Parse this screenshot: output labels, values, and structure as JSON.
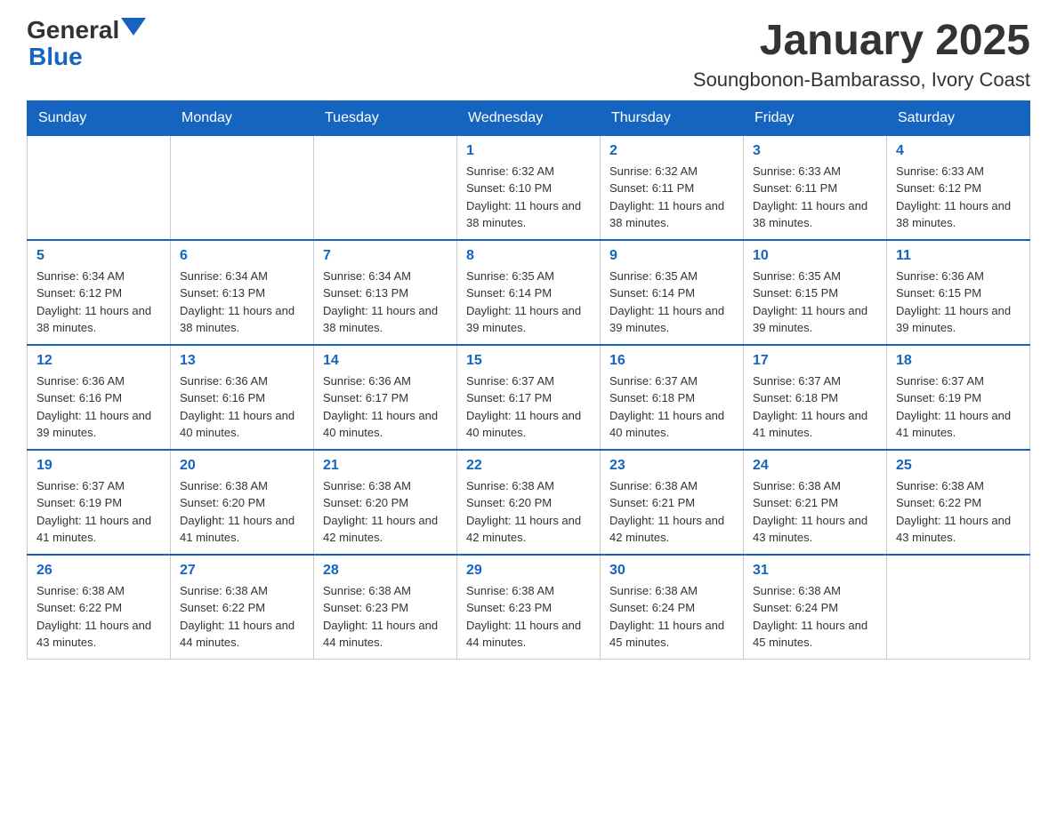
{
  "header": {
    "logo": {
      "general": "General",
      "triangle": "▼",
      "blue": "Blue"
    },
    "title": "January 2025",
    "subtitle": "Soungbonon-Bambarasso, Ivory Coast"
  },
  "days_of_week": [
    "Sunday",
    "Monday",
    "Tuesday",
    "Wednesday",
    "Thursday",
    "Friday",
    "Saturday"
  ],
  "weeks": [
    [
      {
        "day": "",
        "info": ""
      },
      {
        "day": "",
        "info": ""
      },
      {
        "day": "",
        "info": ""
      },
      {
        "day": "1",
        "info": "Sunrise: 6:32 AM\nSunset: 6:10 PM\nDaylight: 11 hours and 38 minutes."
      },
      {
        "day": "2",
        "info": "Sunrise: 6:32 AM\nSunset: 6:11 PM\nDaylight: 11 hours and 38 minutes."
      },
      {
        "day": "3",
        "info": "Sunrise: 6:33 AM\nSunset: 6:11 PM\nDaylight: 11 hours and 38 minutes."
      },
      {
        "day": "4",
        "info": "Sunrise: 6:33 AM\nSunset: 6:12 PM\nDaylight: 11 hours and 38 minutes."
      }
    ],
    [
      {
        "day": "5",
        "info": "Sunrise: 6:34 AM\nSunset: 6:12 PM\nDaylight: 11 hours and 38 minutes."
      },
      {
        "day": "6",
        "info": "Sunrise: 6:34 AM\nSunset: 6:13 PM\nDaylight: 11 hours and 38 minutes."
      },
      {
        "day": "7",
        "info": "Sunrise: 6:34 AM\nSunset: 6:13 PM\nDaylight: 11 hours and 38 minutes."
      },
      {
        "day": "8",
        "info": "Sunrise: 6:35 AM\nSunset: 6:14 PM\nDaylight: 11 hours and 39 minutes."
      },
      {
        "day": "9",
        "info": "Sunrise: 6:35 AM\nSunset: 6:14 PM\nDaylight: 11 hours and 39 minutes."
      },
      {
        "day": "10",
        "info": "Sunrise: 6:35 AM\nSunset: 6:15 PM\nDaylight: 11 hours and 39 minutes."
      },
      {
        "day": "11",
        "info": "Sunrise: 6:36 AM\nSunset: 6:15 PM\nDaylight: 11 hours and 39 minutes."
      }
    ],
    [
      {
        "day": "12",
        "info": "Sunrise: 6:36 AM\nSunset: 6:16 PM\nDaylight: 11 hours and 39 minutes."
      },
      {
        "day": "13",
        "info": "Sunrise: 6:36 AM\nSunset: 6:16 PM\nDaylight: 11 hours and 40 minutes."
      },
      {
        "day": "14",
        "info": "Sunrise: 6:36 AM\nSunset: 6:17 PM\nDaylight: 11 hours and 40 minutes."
      },
      {
        "day": "15",
        "info": "Sunrise: 6:37 AM\nSunset: 6:17 PM\nDaylight: 11 hours and 40 minutes."
      },
      {
        "day": "16",
        "info": "Sunrise: 6:37 AM\nSunset: 6:18 PM\nDaylight: 11 hours and 40 minutes."
      },
      {
        "day": "17",
        "info": "Sunrise: 6:37 AM\nSunset: 6:18 PM\nDaylight: 11 hours and 41 minutes."
      },
      {
        "day": "18",
        "info": "Sunrise: 6:37 AM\nSunset: 6:19 PM\nDaylight: 11 hours and 41 minutes."
      }
    ],
    [
      {
        "day": "19",
        "info": "Sunrise: 6:37 AM\nSunset: 6:19 PM\nDaylight: 11 hours and 41 minutes."
      },
      {
        "day": "20",
        "info": "Sunrise: 6:38 AM\nSunset: 6:20 PM\nDaylight: 11 hours and 41 minutes."
      },
      {
        "day": "21",
        "info": "Sunrise: 6:38 AM\nSunset: 6:20 PM\nDaylight: 11 hours and 42 minutes."
      },
      {
        "day": "22",
        "info": "Sunrise: 6:38 AM\nSunset: 6:20 PM\nDaylight: 11 hours and 42 minutes."
      },
      {
        "day": "23",
        "info": "Sunrise: 6:38 AM\nSunset: 6:21 PM\nDaylight: 11 hours and 42 minutes."
      },
      {
        "day": "24",
        "info": "Sunrise: 6:38 AM\nSunset: 6:21 PM\nDaylight: 11 hours and 43 minutes."
      },
      {
        "day": "25",
        "info": "Sunrise: 6:38 AM\nSunset: 6:22 PM\nDaylight: 11 hours and 43 minutes."
      }
    ],
    [
      {
        "day": "26",
        "info": "Sunrise: 6:38 AM\nSunset: 6:22 PM\nDaylight: 11 hours and 43 minutes."
      },
      {
        "day": "27",
        "info": "Sunrise: 6:38 AM\nSunset: 6:22 PM\nDaylight: 11 hours and 44 minutes."
      },
      {
        "day": "28",
        "info": "Sunrise: 6:38 AM\nSunset: 6:23 PM\nDaylight: 11 hours and 44 minutes."
      },
      {
        "day": "29",
        "info": "Sunrise: 6:38 AM\nSunset: 6:23 PM\nDaylight: 11 hours and 44 minutes."
      },
      {
        "day": "30",
        "info": "Sunrise: 6:38 AM\nSunset: 6:24 PM\nDaylight: 11 hours and 45 minutes."
      },
      {
        "day": "31",
        "info": "Sunrise: 6:38 AM\nSunset: 6:24 PM\nDaylight: 11 hours and 45 minutes."
      },
      {
        "day": "",
        "info": ""
      }
    ]
  ]
}
